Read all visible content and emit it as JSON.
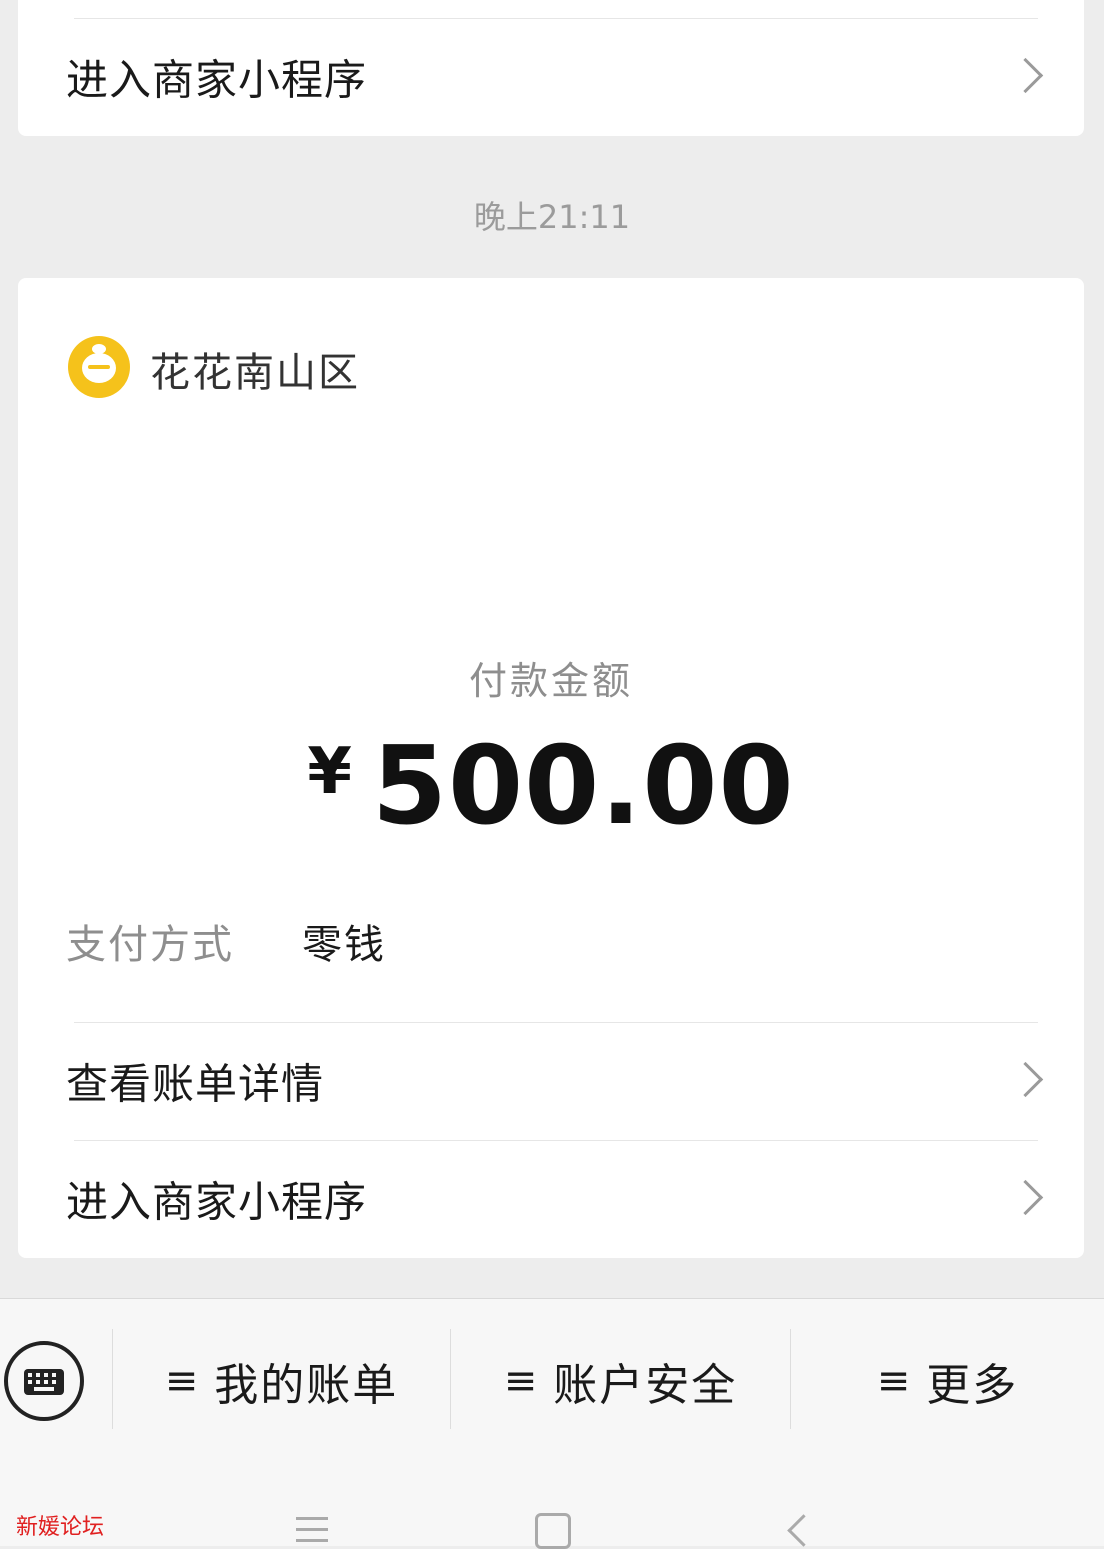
{
  "top_card": {
    "row_label": "进入商家小程序"
  },
  "time_label": "晚上21:11",
  "payment_card": {
    "merchant_name": "花花南山区",
    "amount_label": "付款金额",
    "currency_symbol": "¥",
    "amount_value": "500.00",
    "pay_method_label": "支付方式",
    "pay_method_value": "零钱",
    "rows": [
      {
        "label": "查看账单详情"
      },
      {
        "label": "进入商家小程序"
      }
    ]
  },
  "bottom_menu": {
    "items": [
      {
        "label": "我的账单",
        "prefix": "≡"
      },
      {
        "label": "账户安全",
        "prefix": "≡"
      },
      {
        "label": "更多",
        "prefix": "≡"
      }
    ]
  },
  "nav_bar": {
    "watermark": "新媛论坛"
  },
  "colors": {
    "background": "#ededed",
    "card": "#ffffff",
    "logo": "#f5c21b",
    "watermark": "#e02020"
  },
  "icons": {
    "chevron": "chevron-right-icon",
    "merchant_logo": "merchant-logo-icon",
    "keyboard": "keyboard-icon",
    "menu_lines": "menu-lines-icon",
    "nav_menu": "nav-menu-icon",
    "nav_home": "nav-home-icon",
    "nav_back": "nav-back-icon"
  }
}
